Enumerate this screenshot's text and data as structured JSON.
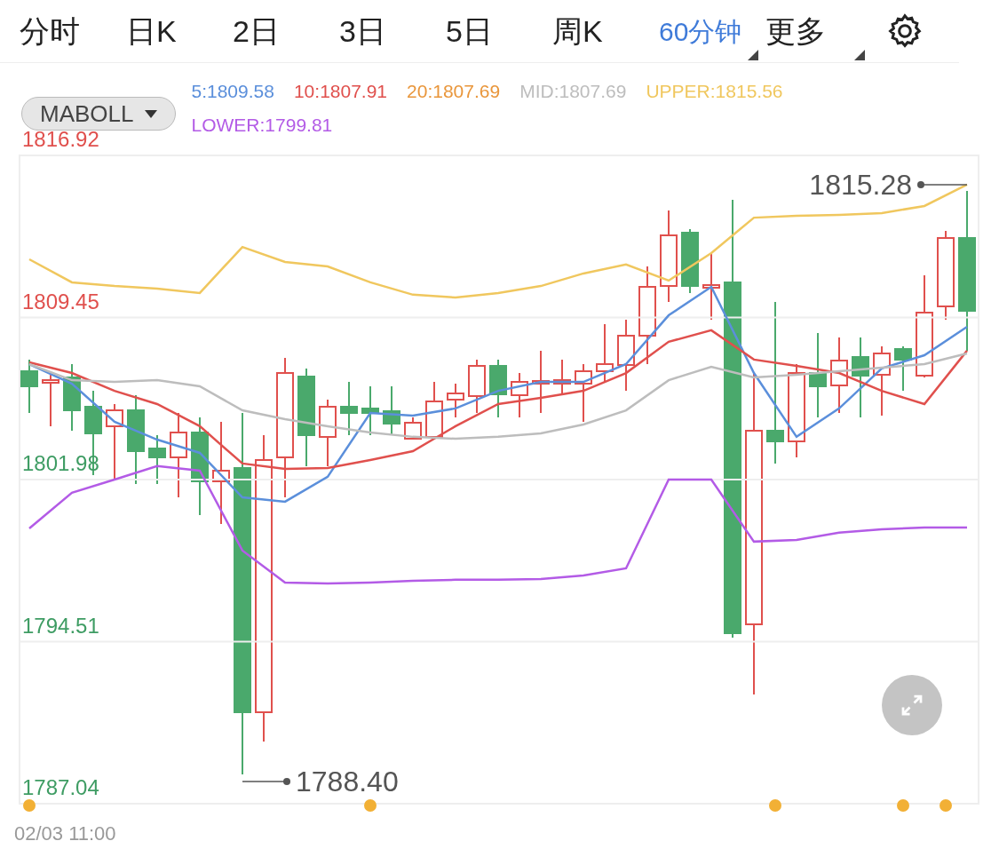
{
  "tabs": [
    {
      "label": "分时",
      "selected": false,
      "dropdown": false
    },
    {
      "label": "日K",
      "selected": false,
      "dropdown": false
    },
    {
      "label": "2日",
      "selected": false,
      "dropdown": false
    },
    {
      "label": "3日",
      "selected": false,
      "dropdown": false
    },
    {
      "label": "5日",
      "selected": false,
      "dropdown": false
    },
    {
      "label": "周K",
      "selected": false,
      "dropdown": false
    },
    {
      "label": "60分钟",
      "selected": true,
      "dropdown": true
    },
    {
      "label": "更多",
      "selected": false,
      "dropdown": true
    }
  ],
  "indicator_select": {
    "value": "MABOLL"
  },
  "ma20_legend": {
    "text": "20:1807.69",
    "color": "#e9963b"
  },
  "chart": {
    "chart_data": {
      "type": "line",
      "grid": true,
      "ylim": [
        1787.04,
        1816.92
      ],
      "yticks": [
        1816.92,
        1809.45,
        1801.98,
        1794.51,
        1787.04
      ],
      "series": [
        {
          "name": "5:1809.58",
          "color": "#5b8fdb",
          "values": [
            1807.3,
            1806.4,
            1804.64,
            1803.82,
            1803.21,
            1801.16,
            1800.96,
            1802.11,
            1805.05,
            1804.93,
            1805.26,
            1806.07,
            1806.48,
            1806.48,
            1807.3,
            1809.55,
            1810.86,
            1806.89,
            1803.95,
            1805.26,
            1807.1,
            1807.71,
            1809.02
          ]
        },
        {
          "name": "10:1807.91",
          "color": "#e0504d",
          "values": [
            1807.38,
            1806.89,
            1806.07,
            1805.46,
            1804.44,
            1802.72,
            1802.47,
            1802.51,
            1802.88,
            1803.29,
            1804.44,
            1805.46,
            1805.75,
            1806.07,
            1806.89,
            1808.33,
            1808.86,
            1807.51,
            1807.22,
            1806.89,
            1806.07,
            1805.46,
            1807.92
          ]
        },
        {
          "name": "MID:1807.69",
          "color": "#bdbdbd",
          "values": [
            1807.3,
            1806.56,
            1806.48,
            1806.56,
            1806.28,
            1805.17,
            1804.76,
            1804.44,
            1804.15,
            1803.95,
            1803.86,
            1803.95,
            1804.11,
            1804.52,
            1805.17,
            1806.56,
            1807.18,
            1806.69,
            1806.81,
            1806.97,
            1807.14,
            1807.3,
            1807.79
          ]
        },
        {
          "name": "UPPER:1815.56",
          "color": "#f0c75e",
          "values": [
            1812.13,
            1811.07,
            1810.9,
            1810.78,
            1810.58,
            1812.7,
            1812.01,
            1811.8,
            1811.07,
            1810.5,
            1810.37,
            1810.58,
            1810.9,
            1811.48,
            1811.89,
            1811.15,
            1812.42,
            1814.05,
            1814.14,
            1814.18,
            1814.26,
            1814.59,
            1815.57
          ]
        },
        {
          "name": "LOWER:1799.81",
          "color": "#b35be6",
          "values": [
            1799.73,
            1801.37,
            1801.98,
            1802.6,
            1802.39,
            1798.71,
            1797.23,
            1797.19,
            1797.23,
            1797.31,
            1797.36,
            1797.36,
            1797.4,
            1797.56,
            1797.89,
            1801.98,
            1801.98,
            1799.12,
            1799.2,
            1799.53,
            1799.69,
            1799.77,
            1799.77
          ]
        }
      ],
      "annotations": [
        "1815.28",
        "1788.40"
      ]
    }
  },
  "time_label": "02/03 11:00"
}
